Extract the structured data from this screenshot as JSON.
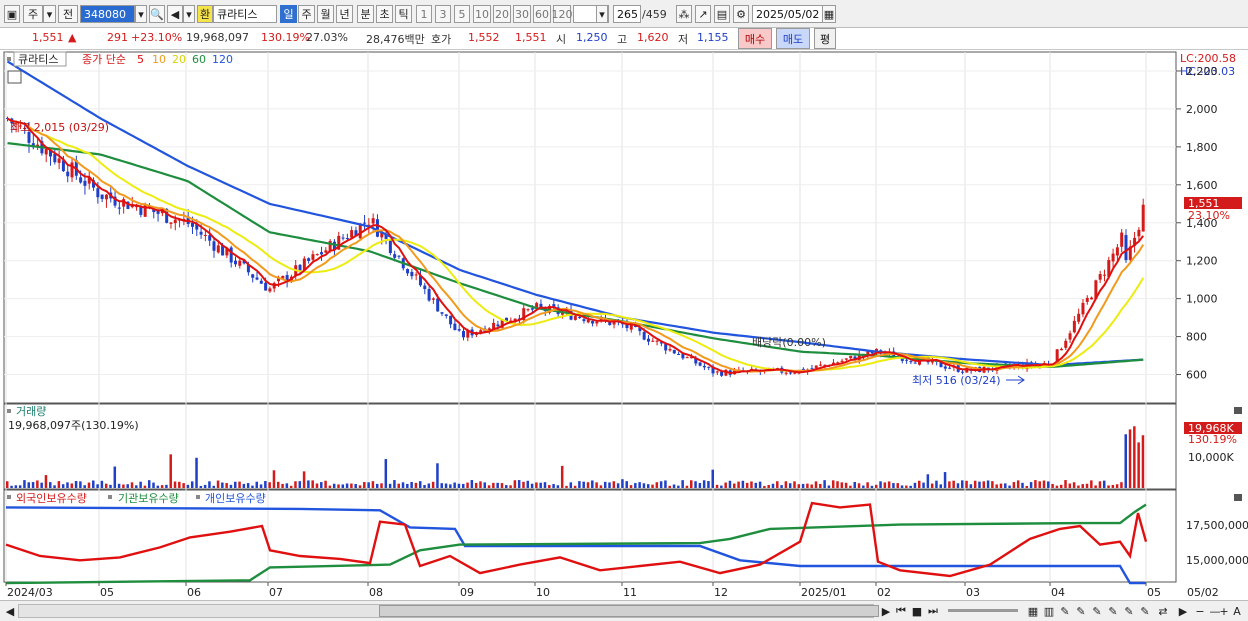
{
  "toolbar": {
    "market": "주",
    "view": "전",
    "code": "348080",
    "name_badge": "환",
    "name": "큐라티스",
    "periods": [
      "일",
      "주",
      "월",
      "년",
      "분",
      "초",
      "틱"
    ],
    "intervals": [
      "1",
      "3",
      "5",
      "10",
      "20",
      "30",
      "60",
      "120"
    ],
    "count": "265",
    "total": "/459",
    "date": "2025/05/02"
  },
  "quote": {
    "price": "1,551",
    "arrow": "▲",
    "change": "291",
    "change_pct": "+23.10%",
    "volume": "19,968,097",
    "vol_ratio": "130.19%",
    "turnover": "27.03%",
    "amount": "28,476백만",
    "hoga_label": "호가",
    "ask": "1,552",
    "bid": "1,551",
    "open_label": "시",
    "open": "1,250",
    "high_label": "고",
    "high": "1,620",
    "low_label": "저",
    "low": "1,155",
    "buy": "매수",
    "sell": "매도",
    "eval": "평"
  },
  "legend": {
    "name": "큐라티스",
    "prefix": "종가 단순",
    "ma": [
      {
        "label": "5",
        "color": "#e01010"
      },
      {
        "label": "10",
        "color": "#f29a1c"
      },
      {
        "label": "20",
        "color": "#ecec10"
      },
      {
        "label": "60",
        "color": "#1e8e3e"
      },
      {
        "label": "120",
        "color": "#2255dd"
      }
    ]
  },
  "price_axis": {
    "top_labels": [
      "LC:200.58",
      "HC:-23.03"
    ],
    "ticks": [
      "2,200",
      "2,000",
      "1,800",
      "1,600",
      "1,400",
      "1,200",
      "1,000",
      "800",
      "600"
    ],
    "current": "1,551",
    "current_pct": "23.10%"
  },
  "annotations": {
    "high": "최고 2,015 (03/29)",
    "low": "최저 516 (03/24)",
    "dividend": "배당락(0.00%)"
  },
  "volume": {
    "title": "거래량",
    "value": "19,968,097주(130.19%)",
    "axis_current": "19,968K",
    "axis_pct": "130.19%",
    "tick": "10,000K"
  },
  "holdings": {
    "legend": [
      "외국인보유수량",
      "기관보유수량",
      "개인보유수량"
    ],
    "ticks": [
      "17,500,000",
      "15,000,000"
    ]
  },
  "dates": [
    "2024/03",
    "05",
    "06",
    "07",
    "08",
    "09",
    "10",
    "11",
    "12",
    "2025/01",
    "02",
    "03",
    "04",
    "05",
    "05/02"
  ],
  "colors": {
    "up": "#d41b1b",
    "down": "#1f3fc7",
    "ma5": "#e01010",
    "ma10": "#f29a1c",
    "ma20": "#ecec10",
    "ma60": "#1e8e3e",
    "ma120": "#2255dd"
  },
  "chart_data": {
    "type": "line",
    "price_ylim": [
      450,
      2300
    ],
    "close_series": [
      {
        "name": "종가",
        "x_dates": [
          "2024/03",
          "05",
          "06",
          "07",
          "08",
          "09",
          "10",
          "11",
          "12",
          "2025/01",
          "02",
          "03",
          "04",
          "05"
        ],
        "values": [
          1950,
          1550,
          1400,
          1050,
          1420,
          800,
          950,
          860,
          610,
          620,
          720,
          620,
          660,
          1551
        ]
      }
    ],
    "ma120_values": [
      2250,
      1950,
      1700,
      1500,
      1380,
      1150,
      1020,
      900,
      820,
      770,
      720,
      680,
      650,
      680
    ],
    "ma60_values": [
      1820,
      1760,
      1620,
      1350,
      1250,
      1080,
      950,
      880,
      790,
      720,
      700,
      660,
      640,
      680
    ],
    "volume_spikes": [
      {
        "date": "05/02",
        "value": 19968097
      }
    ]
  }
}
